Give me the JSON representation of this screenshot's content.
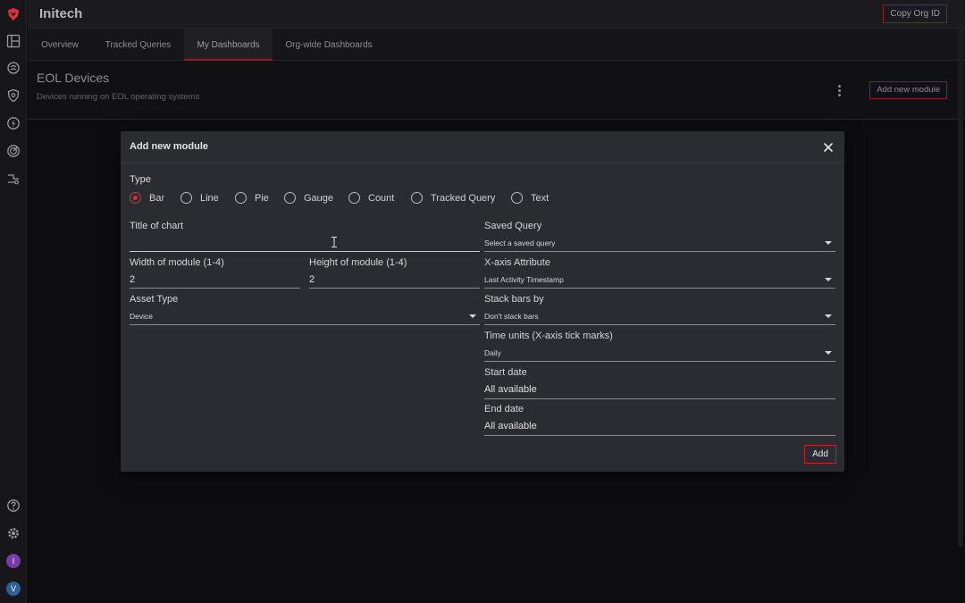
{
  "header": {
    "org_name": "Initech",
    "copy_org_label": "Copy Org ID"
  },
  "tabs": [
    {
      "label": "Overview"
    },
    {
      "label": "Tracked Queries"
    },
    {
      "label": "My Dashboards",
      "active": true
    },
    {
      "label": "Org-wide Dashboards"
    }
  ],
  "dashboard": {
    "title": "EOL Devices",
    "subtitle": "Devices running on EOL operating systems",
    "add_module_label": "Add new module"
  },
  "rail": {
    "avatars": [
      "I",
      "V"
    ],
    "colors": {
      "avatar_i": "#7a3aa8",
      "avatar_v": "#2e5f9a",
      "brand": "#d9303b"
    }
  },
  "modal": {
    "title": "Add new module",
    "type_label": "Type",
    "types": [
      "Bar",
      "Line",
      "Pie",
      "Gauge",
      "Count",
      "Tracked Query",
      "Text"
    ],
    "selected_type": "Bar",
    "title_of_chart": {
      "label": "Title of chart",
      "value": ""
    },
    "width": {
      "label": "Width of module (1-4)",
      "value": "2"
    },
    "height": {
      "label": "Height of module (1-4)",
      "value": "2"
    },
    "asset_type": {
      "label": "Asset Type",
      "value": "Device"
    },
    "saved_query": {
      "label": "Saved Query",
      "value": "Select a saved query"
    },
    "x_axis": {
      "label": "X-axis Attribute",
      "value": "Last Activity Timestamp"
    },
    "stack_bars": {
      "label": "Stack bars by",
      "value": "Don't stack bars"
    },
    "time_units": {
      "label": "Time units (X-axis tick marks)",
      "value": "Daily"
    },
    "start_date": {
      "label": "Start date",
      "value": "All available"
    },
    "end_date": {
      "label": "End date",
      "value": "All available"
    },
    "add_label": "Add"
  }
}
